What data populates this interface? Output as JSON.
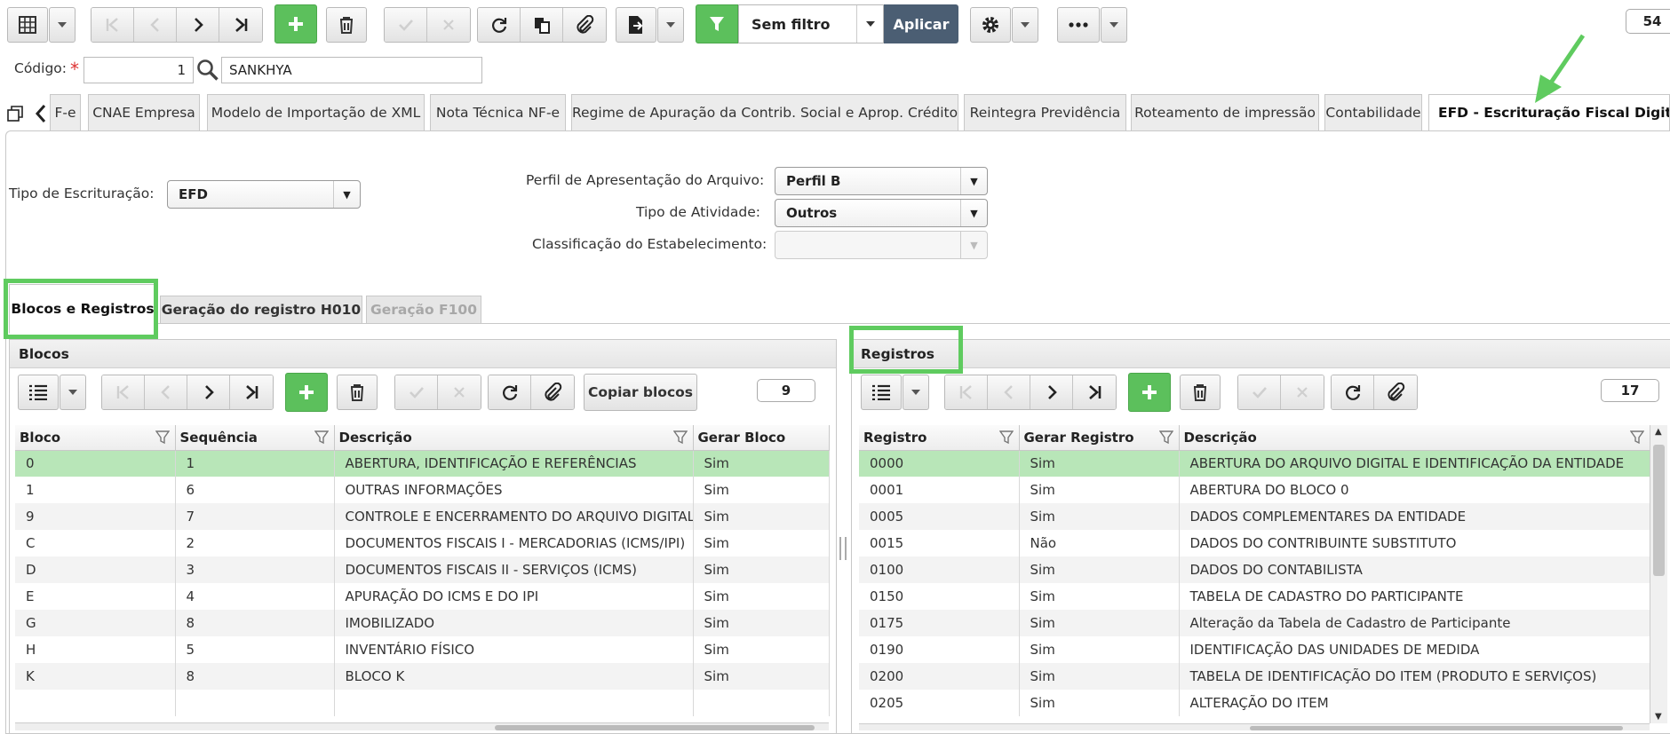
{
  "toolbar": {
    "filter_label": "Sem filtro",
    "apply_label": "Aplicar",
    "record_count": "54"
  },
  "header": {
    "codigo_label": "Código:",
    "required_mark": "*",
    "codigo_value": "1",
    "empresa_value": "SANKHYA"
  },
  "tabs": [
    {
      "label": "F-e"
    },
    {
      "label": "CNAE Empresa"
    },
    {
      "label": "Modelo de Importação de XML"
    },
    {
      "label": "Nota Técnica NF-e"
    },
    {
      "label": "Regime de Apuração da Contrib. Social e Aprop. Crédito"
    },
    {
      "label": "Reintegra Previdência"
    },
    {
      "label": "Roteamento de impressão"
    },
    {
      "label": "Contabilidade"
    },
    {
      "label": "EFD - Escrituração Fiscal Digital"
    }
  ],
  "form": {
    "tipo_escrituracao_label": "Tipo de Escrituração:",
    "tipo_escrituracao_value": "EFD",
    "perfil_label": "Perfil de Apresentação do Arquivo:",
    "perfil_value": "Perfil B",
    "tipo_atividade_label": "Tipo de Atividade:",
    "tipo_atividade_value": "Outros",
    "classificacao_label": "Classificação do Estabelecimento:",
    "classificacao_value": ""
  },
  "subtabs": [
    {
      "label": "Blocos e Registros"
    },
    {
      "label": "Geração do registro H010"
    },
    {
      "label": "Geração F100"
    }
  ],
  "blocos": {
    "title": "Blocos",
    "copy_label": "Copiar blocos",
    "count": "9",
    "columns": [
      "Bloco",
      "Sequência",
      "Descrição",
      "Gerar Bloco"
    ],
    "rows": [
      {
        "bloco": "0",
        "seq": "1",
        "desc": "ABERTURA, IDENTIFICAÇÃO E REFERÊNCIAS",
        "gerar": "Sim"
      },
      {
        "bloco": "1",
        "seq": "6",
        "desc": "OUTRAS INFORMAÇÕES",
        "gerar": "Sim"
      },
      {
        "bloco": "9",
        "seq": "7",
        "desc": "CONTROLE E ENCERRAMENTO DO ARQUIVO DIGITAL",
        "gerar": "Sim"
      },
      {
        "bloco": "C",
        "seq": "2",
        "desc": "DOCUMENTOS FISCAIS I - MERCADORIAS (ICMS/IPI)",
        "gerar": "Sim"
      },
      {
        "bloco": "D",
        "seq": "3",
        "desc": "DOCUMENTOS FISCAIS II - SERVIÇOS (ICMS)",
        "gerar": "Sim"
      },
      {
        "bloco": "E",
        "seq": "4",
        "desc": "APURAÇÃO DO ICMS E DO IPI",
        "gerar": "Sim"
      },
      {
        "bloco": "G",
        "seq": "8",
        "desc": "IMOBILIZADO",
        "gerar": "Sim"
      },
      {
        "bloco": "H",
        "seq": "5",
        "desc": "INVENTÁRIO FÍSICO",
        "gerar": "Sim"
      },
      {
        "bloco": "K",
        "seq": "8",
        "desc": "BLOCO K",
        "gerar": "Sim"
      }
    ]
  },
  "registros": {
    "title": "Registros",
    "count": "17",
    "columns": [
      "Registro",
      "Gerar Registro",
      "Descrição"
    ],
    "rows": [
      {
        "reg": "0000",
        "gerar": "Sim",
        "desc": "ABERTURA DO ARQUIVO DIGITAL E IDENTIFICAÇÃO DA ENTIDADE"
      },
      {
        "reg": "0001",
        "gerar": "Sim",
        "desc": "ABERTURA DO BLOCO 0"
      },
      {
        "reg": "0005",
        "gerar": "Sim",
        "desc": "DADOS COMPLEMENTARES DA ENTIDADE"
      },
      {
        "reg": "0015",
        "gerar": "Não",
        "desc": "DADOS DO CONTRIBUINTE SUBSTITUTO"
      },
      {
        "reg": "0100",
        "gerar": "Sim",
        "desc": "DADOS DO CONTABILISTA"
      },
      {
        "reg": "0150",
        "gerar": "Sim",
        "desc": "TABELA DE CADASTRO DO PARTICIPANTE"
      },
      {
        "reg": "0175",
        "gerar": "Sim",
        "desc": "Alteração da Tabela de Cadastro de Participante"
      },
      {
        "reg": "0190",
        "gerar": "Sim",
        "desc": "IDENTIFICAÇÃO DAS UNIDADES DE MEDIDA"
      },
      {
        "reg": "0200",
        "gerar": "Sim",
        "desc": "TABELA DE IDENTIFICAÇÃO DO ITEM (PRODUTO E SERVIÇOS)"
      },
      {
        "reg": "0205",
        "gerar": "Sim",
        "desc": "ALTERAÇÃO DO ITEM"
      }
    ]
  },
  "colors": {
    "accent_green": "#5cc05c",
    "selected_row": "#b8e6b8",
    "apply_button": "#4b5e73",
    "annotation_green": "#5fcb5f"
  }
}
